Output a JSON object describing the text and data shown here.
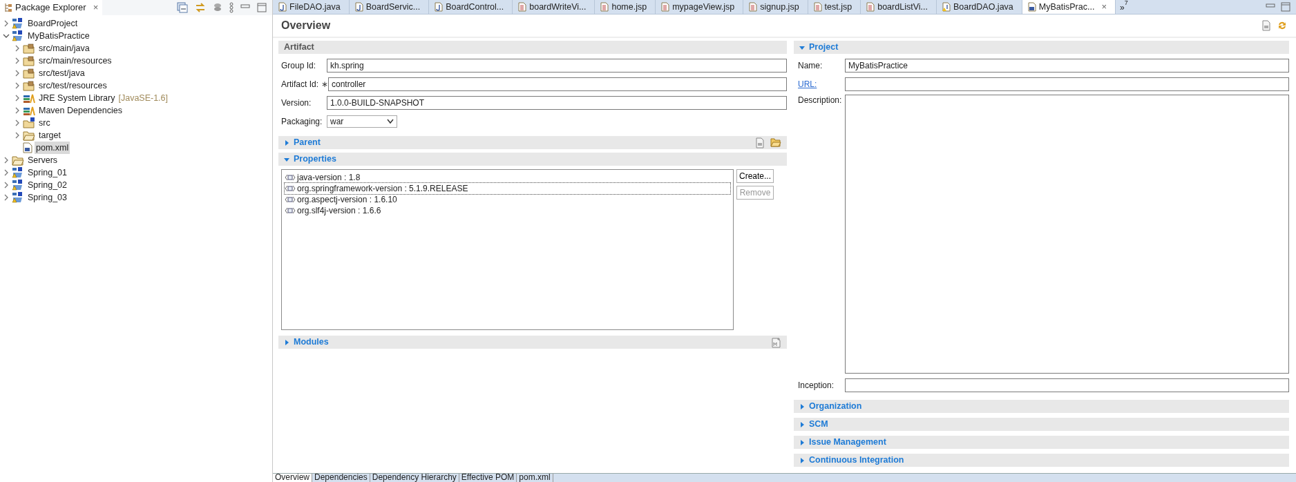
{
  "explorer": {
    "title": "Package Explorer",
    "close": "×",
    "tree": [
      {
        "label": "BoardProject",
        "kind": "project",
        "expanded": false,
        "selected": false
      },
      {
        "label": "MyBatisPractice",
        "kind": "project",
        "expanded": true,
        "selected": false,
        "children": [
          {
            "label": "src/main/java",
            "kind": "package-folder",
            "expanded": false,
            "selected": false
          },
          {
            "label": "src/main/resources",
            "kind": "package-folder",
            "expanded": false,
            "selected": false
          },
          {
            "label": "src/test/java",
            "kind": "package-folder",
            "expanded": false,
            "selected": false
          },
          {
            "label": "src/test/resources",
            "kind": "package-folder",
            "expanded": false,
            "selected": false
          },
          {
            "label": "JRE System Library",
            "decoration": "[JavaSE-1.6]",
            "kind": "library",
            "expanded": false,
            "selected": false
          },
          {
            "label": "Maven Dependencies",
            "kind": "library",
            "expanded": false,
            "selected": false
          },
          {
            "label": "src",
            "kind": "source-folder",
            "expanded": false,
            "selected": false
          },
          {
            "label": "target",
            "kind": "folder",
            "expanded": false,
            "selected": false
          },
          {
            "label": "pom.xml",
            "kind": "file",
            "selected": true
          }
        ]
      },
      {
        "label": "Servers",
        "kind": "folder",
        "expanded": false,
        "selected": false
      },
      {
        "label": "Spring_01",
        "kind": "project",
        "expanded": false,
        "selected": false
      },
      {
        "label": "Spring_02",
        "kind": "project",
        "expanded": false,
        "selected": false
      },
      {
        "label": "Spring_03",
        "kind": "project",
        "expanded": false,
        "selected": false
      }
    ]
  },
  "editor_tabs": [
    {
      "label": "FileDAO.java",
      "kind": "java",
      "selected": false
    },
    {
      "label": "BoardServic...",
      "kind": "java",
      "selected": false
    },
    {
      "label": "BoardControl...",
      "kind": "java",
      "selected": false
    },
    {
      "label": "boardWriteVi...",
      "kind": "jsp",
      "selected": false
    },
    {
      "label": "home.jsp",
      "kind": "jsp",
      "selected": false
    },
    {
      "label": "mypageView.jsp",
      "kind": "jsp",
      "selected": false
    },
    {
      "label": "signup.jsp",
      "kind": "jsp",
      "selected": false
    },
    {
      "label": "test.jsp",
      "kind": "jsp",
      "selected": false
    },
    {
      "label": "boardListVi...",
      "kind": "jsp",
      "selected": false
    },
    {
      "label": "BoardDAO.java",
      "kind": "java-warning",
      "selected": false
    },
    {
      "label": "MyBatisPrac...",
      "kind": "pom",
      "selected": true,
      "close": "×"
    }
  ],
  "tab_overflow": {
    "glyph": "»",
    "count": "7"
  },
  "page_title": "Overview",
  "artifact": {
    "title": "Artifact",
    "fields": [
      {
        "label": "Group Id:",
        "value": "kh.spring"
      },
      {
        "label": "Artifact Id:",
        "required_mark": "∗",
        "value": "controller"
      },
      {
        "label": "Version:",
        "value": "1.0.0-BUILD-SNAPSHOT"
      }
    ],
    "packaging": {
      "label": "Packaging:",
      "value": "war"
    }
  },
  "parent": {
    "title": "Parent",
    "expanded": false
  },
  "properties": {
    "title": "Properties",
    "expanded": true,
    "items": [
      {
        "text": "java-version : 1.8",
        "selected": false
      },
      {
        "text": "org.springframework-version : 5.1.9.RELEASE",
        "selected": true
      },
      {
        "text": "org.aspectj-version : 1.6.10",
        "selected": false
      },
      {
        "text": "org.slf4j-version : 1.6.6",
        "selected": false
      }
    ],
    "buttons": [
      {
        "label": "Create...",
        "disabled": false
      },
      {
        "label": "Remove",
        "disabled": true
      }
    ]
  },
  "modules": {
    "title": "Modules",
    "expanded": false
  },
  "project": {
    "title": "Project",
    "expanded": true,
    "fields": [
      {
        "label": "Name:",
        "kind": "text",
        "value": "MyBatisPractice"
      },
      {
        "label": "URL:",
        "kind": "link"
      },
      {
        "label": "Description:",
        "kind": "multiline"
      },
      {
        "label": "Inception:",
        "kind": "text"
      }
    ]
  },
  "collapsed_sections": [
    {
      "title": "Organization",
      "expanded": false
    },
    {
      "title": "SCM",
      "expanded": false
    },
    {
      "title": "Issue Management",
      "expanded": false
    },
    {
      "title": "Continuous Integration",
      "expanded": false
    }
  ],
  "bottom_tabs": [
    {
      "label": "Overview",
      "selected": true
    },
    {
      "label": "Dependencies",
      "selected": false
    },
    {
      "label": "Dependency Hierarchy",
      "selected": false
    },
    {
      "label": "Effective POM",
      "selected": false
    },
    {
      "label": "pom.xml",
      "selected": false
    }
  ]
}
